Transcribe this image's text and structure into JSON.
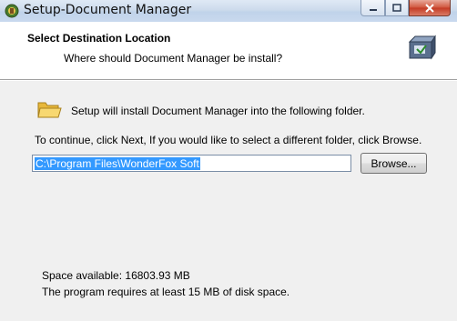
{
  "window": {
    "title": "Setup-Document Manager"
  },
  "header": {
    "title": "Select Destination Location",
    "subtitle": "Where should Document Manager be install?",
    "icon": "install-box-icon"
  },
  "body": {
    "intro": "Setup will install Document Manager into the following folder.",
    "instruction": "To continue, click Next, If you would like to select a different folder, click Browse.",
    "path_value": "C:\\Program Files\\WonderFox Soft",
    "browse_label": "Browse...",
    "space_available": "Space available: 16803.93 MB",
    "space_required": "The program requires at least 15 MB of disk space."
  },
  "colors": {
    "selection": "#3399ff",
    "close_button": "#c43a24",
    "folder": "#f2c94c"
  }
}
